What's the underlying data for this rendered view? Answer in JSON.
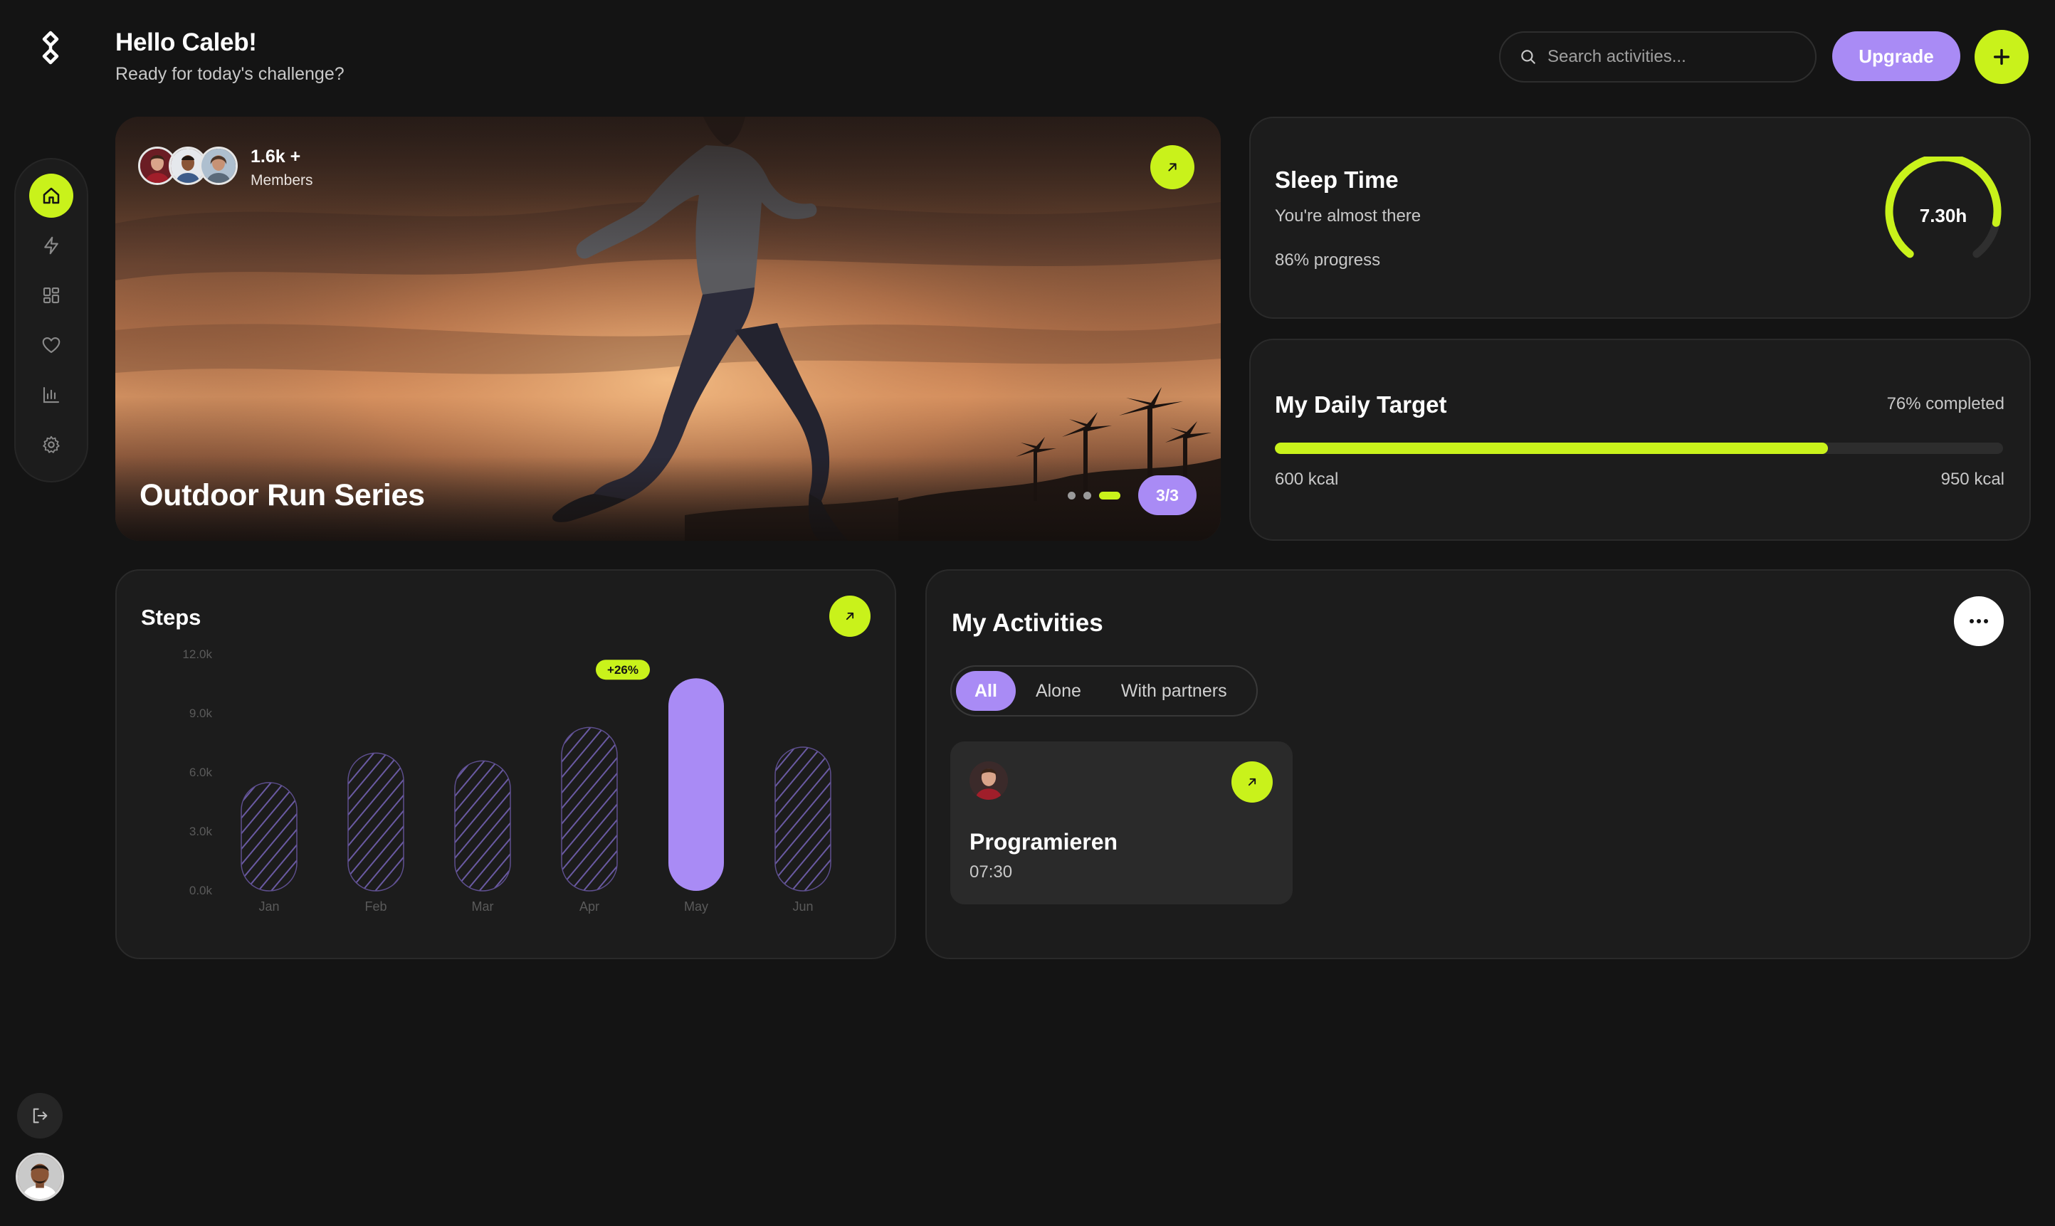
{
  "header": {
    "greeting": "Hello Caleb!",
    "subtitle": "Ready for today's challenge?",
    "search_placeholder": "Search activities...",
    "upgrade_label": "Upgrade"
  },
  "sidebar": {
    "items": [
      {
        "icon": "home-icon",
        "active": true
      },
      {
        "icon": "lightning-icon",
        "active": false
      },
      {
        "icon": "grid-icon",
        "active": false
      },
      {
        "icon": "heart-icon",
        "active": false
      },
      {
        "icon": "bar-chart-icon",
        "active": false
      },
      {
        "icon": "gear-icon",
        "active": false
      }
    ],
    "logout_icon": "logout-icon"
  },
  "hero": {
    "members_count": "1.6k +",
    "members_label": "Members",
    "title": "Outdoor Run Series",
    "slide_indicator": "3/3",
    "slide_count": 3,
    "active_slide": 3
  },
  "sleep": {
    "title": "Sleep Time",
    "subtitle": "You're almost there",
    "progress_text": "86% progress",
    "progress": 0.86,
    "value": "7.30h"
  },
  "daily_target": {
    "title": "My Daily Target",
    "completed_text": "76% completed",
    "progress": 0.76,
    "min_label": "600 kcal",
    "max_label": "950 kcal"
  },
  "steps": {
    "title": "Steps",
    "badge": "+26%"
  },
  "chart_data": {
    "type": "bar",
    "categories": [
      "Jan",
      "Feb",
      "Mar",
      "Apr",
      "May",
      "Jun"
    ],
    "values": [
      5.5,
      7.0,
      6.6,
      8.3,
      10.8,
      7.3
    ],
    "highlight_index": 4,
    "y_ticks": [
      "0.0k",
      "3.0k",
      "6.0k",
      "9.0k",
      "12.0k"
    ],
    "ylim": [
      0,
      12
    ],
    "grid": false,
    "colors": {
      "highlight": "#a98bf5",
      "hatch": "#5e4f8f",
      "badge": "#c9f21b"
    }
  },
  "activities": {
    "title": "My Activities",
    "tabs": [
      {
        "label": "All",
        "active": true
      },
      {
        "label": "Alone",
        "active": false
      },
      {
        "label": "With partners",
        "active": false
      }
    ],
    "items": [
      {
        "name": "Programieren",
        "time": "07:30"
      }
    ]
  },
  "colors": {
    "accent_lime": "#c9f21b",
    "accent_purple": "#a98bf5",
    "background": "#141414",
    "card": "#1c1c1c"
  }
}
